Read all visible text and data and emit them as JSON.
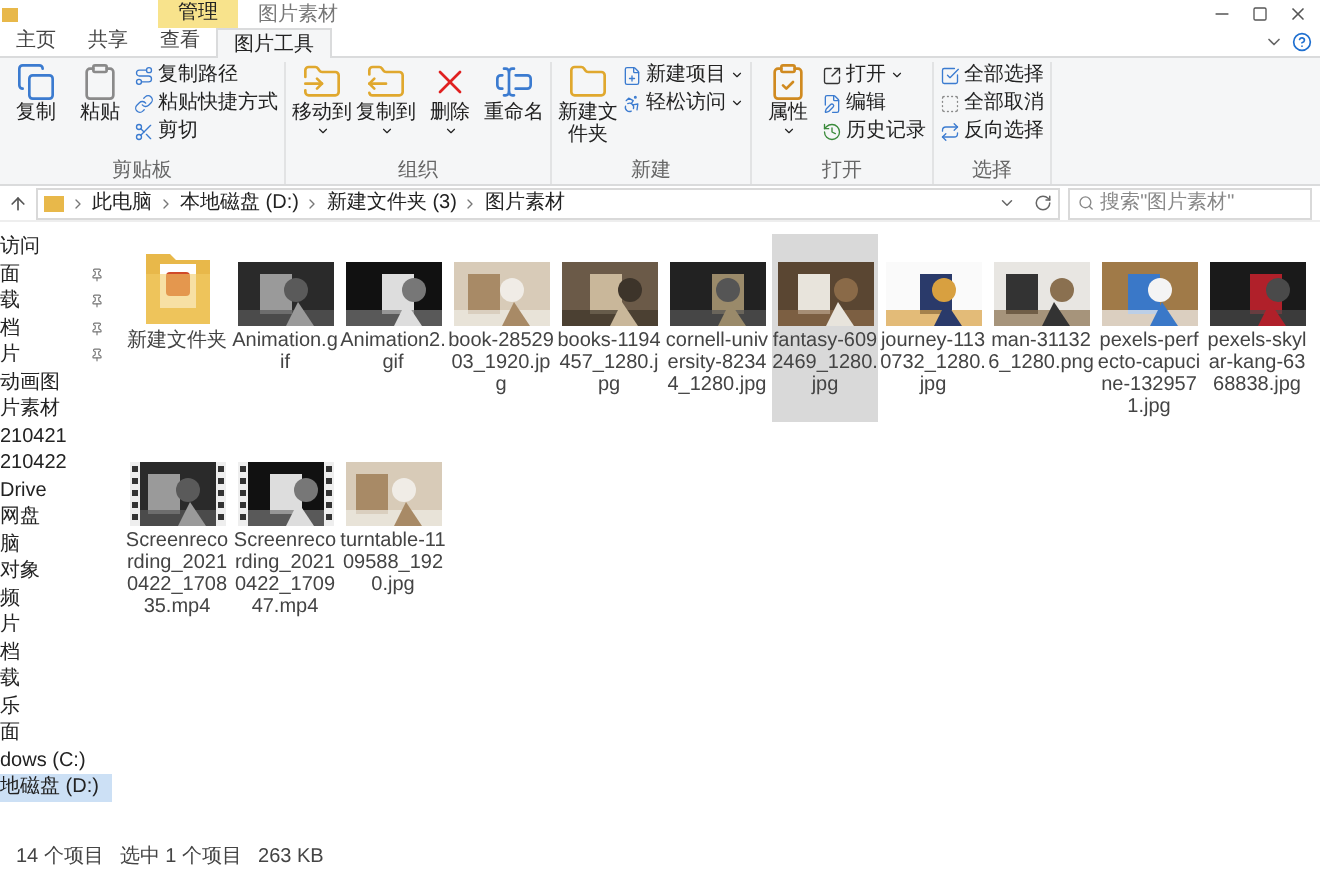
{
  "window": {
    "title": "图片素材",
    "context_tab": "管理"
  },
  "tabs": [
    {
      "label": "主页",
      "selected": false
    },
    {
      "label": "共享",
      "selected": false
    },
    {
      "label": "查看",
      "selected": false
    },
    {
      "label": "图片工具",
      "selected": true
    }
  ],
  "ribbon": [
    {
      "label": "剪贴板",
      "large": [
        {
          "label": "复制",
          "dropdown": false
        },
        {
          "label": "粘贴",
          "dropdown": false
        }
      ],
      "small": [
        {
          "label": "复制路径",
          "dropdown": false
        },
        {
          "label": "粘贴快捷方式",
          "dropdown": false
        },
        {
          "label": "剪切",
          "dropdown": false
        }
      ]
    },
    {
      "label": "组织",
      "large": [
        {
          "label": "移动到",
          "dropdown": true
        },
        {
          "label": "复制到",
          "dropdown": true
        },
        {
          "label": "删除",
          "dropdown": true
        },
        {
          "label": "重命名",
          "dropdown": false
        }
      ]
    },
    {
      "label": "新建",
      "large": [
        {
          "label": "新建文件夹",
          "dropdown": false
        }
      ],
      "small": [
        {
          "label": "新建项目",
          "dropdown": true
        },
        {
          "label": "轻松访问",
          "dropdown": true
        }
      ]
    },
    {
      "label": "打开",
      "large": [
        {
          "label": "属性",
          "dropdown": true
        }
      ],
      "small": [
        {
          "label": "打开",
          "dropdown": true
        },
        {
          "label": "编辑",
          "dropdown": false
        },
        {
          "label": "历史记录",
          "dropdown": false
        }
      ]
    },
    {
      "label": "选择",
      "small": [
        {
          "label": "全部选择",
          "dropdown": false
        },
        {
          "label": "全部取消",
          "dropdown": false
        },
        {
          "label": "反向选择",
          "dropdown": false
        }
      ]
    }
  ],
  "address": {
    "path": [
      "此电脑",
      "本地磁盘 (D:)",
      "新建文件夹 (3)",
      "图片素材"
    ],
    "search_placeholder": "搜索\"图片素材\""
  },
  "nav": [
    {
      "label": "访问",
      "pinned": false,
      "selected": false
    },
    {
      "label": "面",
      "pinned": true,
      "selected": false
    },
    {
      "label": "载",
      "pinned": true,
      "selected": false
    },
    {
      "label": "档",
      "pinned": true,
      "selected": false
    },
    {
      "label": "片",
      "pinned": true,
      "selected": false
    },
    {
      "label": "动画图",
      "pinned": false,
      "selected": false
    },
    {
      "label": "片素材",
      "pinned": false,
      "selected": false
    },
    {
      "label": "210421",
      "pinned": false,
      "selected": false
    },
    {
      "label": "210422",
      "pinned": false,
      "selected": false
    },
    {
      "label": "Drive",
      "pinned": false,
      "selected": false
    },
    {
      "label": "网盘",
      "pinned": false,
      "selected": false
    },
    {
      "label": "脑",
      "pinned": false,
      "selected": false
    },
    {
      "label": "对象",
      "pinned": false,
      "selected": false
    },
    {
      "label": "频",
      "pinned": false,
      "selected": false
    },
    {
      "label": "片",
      "pinned": false,
      "selected": false
    },
    {
      "label": "档",
      "pinned": false,
      "selected": false
    },
    {
      "label": "载",
      "pinned": false,
      "selected": false
    },
    {
      "label": "乐",
      "pinned": false,
      "selected": false
    },
    {
      "label": "面",
      "pinned": false,
      "selected": false
    },
    {
      "label": "dows (C:)",
      "pinned": false,
      "selected": false
    },
    {
      "label": "地磁盘 (D:)",
      "pinned": false,
      "selected": true
    }
  ],
  "files": [
    {
      "name": "新建文件夹",
      "kind": "folder",
      "selected": false
    },
    {
      "name": "Animation.gif",
      "selected": false
    },
    {
      "name": "Animation2.gif",
      "selected": false
    },
    {
      "name": "book-2852903_1920.jpg",
      "selected": false
    },
    {
      "name": "books-1194457_1280.jpg",
      "selected": false
    },
    {
      "name": "cornell-university-82344_1280.jpg",
      "selected": false
    },
    {
      "name": "fantasy-6092469_1280.jpg",
      "selected": true
    },
    {
      "name": "journey-1130732_1280.jpg",
      "selected": false
    },
    {
      "name": "man-311326_1280.png",
      "selected": false
    },
    {
      "name": "pexels-perfecto-capucine-1329571.jpg",
      "selected": false
    },
    {
      "name": "pexels-skylar-kang-6368838.jpg",
      "selected": false
    },
    {
      "name": "Screenrecording_20210422_170835.mp4",
      "kind": "video",
      "selected": false
    },
    {
      "name": "Screenrecording_20210422_170947.mp4",
      "kind": "video",
      "selected": false
    },
    {
      "name": "turntable-1109588_1920.jpg",
      "selected": false
    }
  ],
  "status": [
    "14 个项目",
    "选中 1 个项目",
    "263 KB"
  ]
}
